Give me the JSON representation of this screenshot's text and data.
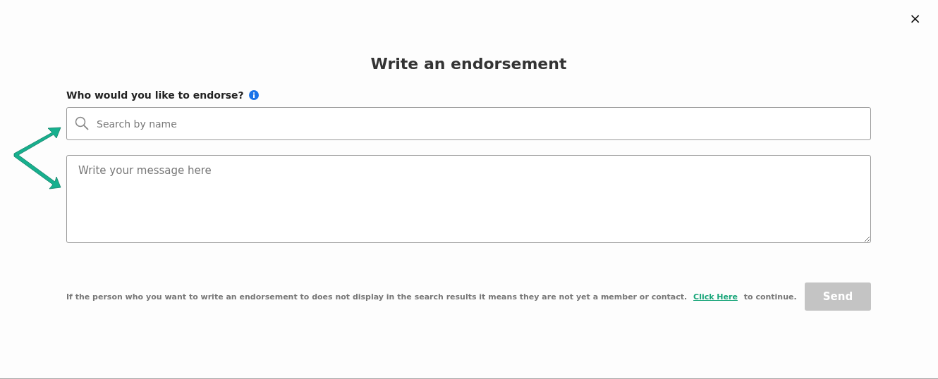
{
  "close": "×",
  "title": "Write an endorsement",
  "question": "Who would you like to endorse?",
  "search": {
    "placeholder": "Search by name"
  },
  "message": {
    "placeholder": "Write your message here"
  },
  "note": {
    "before": "If the person who you want to write an endorsement to does not display in the search results it means they are not yet a member or contact.",
    "link": "Click Here",
    "after": "to continue."
  },
  "send": {
    "label": "Send",
    "disabled": true
  }
}
